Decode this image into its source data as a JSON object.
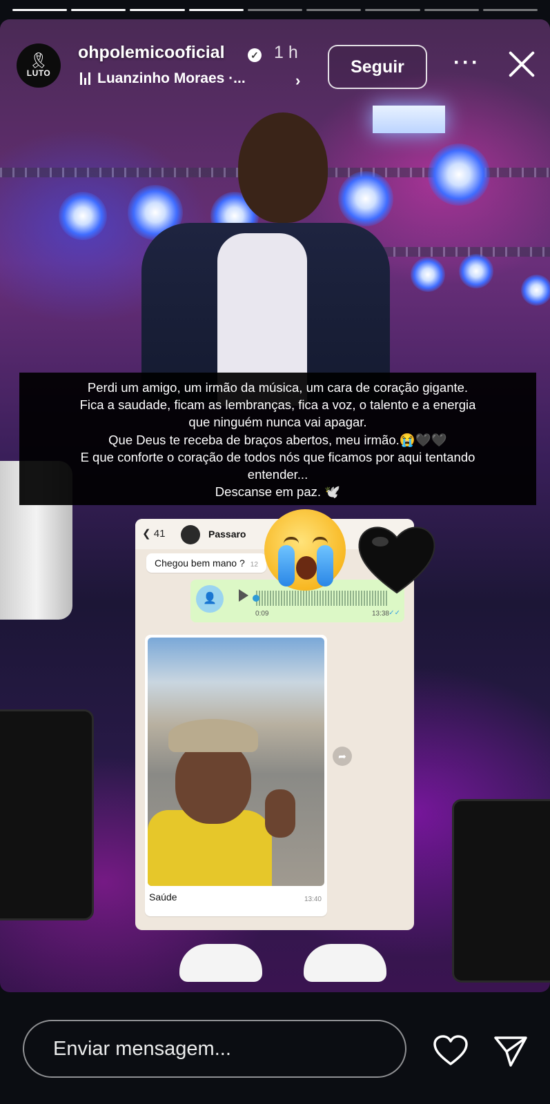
{
  "story": {
    "progress_total": 9,
    "progress_done": 4,
    "avatar_text": "LUTO",
    "avatar_icon": "black-ribbon-icon",
    "username": "ohpolemicooficial",
    "verified_icon": "verified-badge-icon",
    "time": "1 h",
    "music": "Luanzinho Moraes ·...",
    "music_icon": "music-bars-icon",
    "follow_label": "Seguir",
    "more_icon": "more-dots-icon",
    "close_icon": "close-icon"
  },
  "caption": {
    "lines": [
      "Perdi um amigo, um irmão da música, um cara de coração gigante.",
      "Fica a saudade, ficam as lembranças, fica a voz, o talento e a energia",
      "que ninguém nunca vai apagar.",
      "Que Deus te receba de braços abertos, meu irmão.😭🖤🖤",
      "E que conforte o coração de todos nós que ficamos por aqui tentando",
      "entender...",
      "Descanse em paz. 🕊️"
    ]
  },
  "chat": {
    "back_count": "41",
    "contact": "Passaro",
    "msg1": "Chegou bem mano ?",
    "msg1_time": "12",
    "audio_duration": "0:09",
    "audio_time": "13:38",
    "photo_caption": "Saúde",
    "photo_time": "13:40"
  },
  "bottom": {
    "placeholder": "Enviar mensagem...",
    "like_icon": "heart-outline-icon",
    "send_icon": "send-icon"
  },
  "colors": {
    "background": "#0b0d12",
    "chat_bg": "#efe7dd",
    "audio_bubble": "#dcf8c6"
  }
}
